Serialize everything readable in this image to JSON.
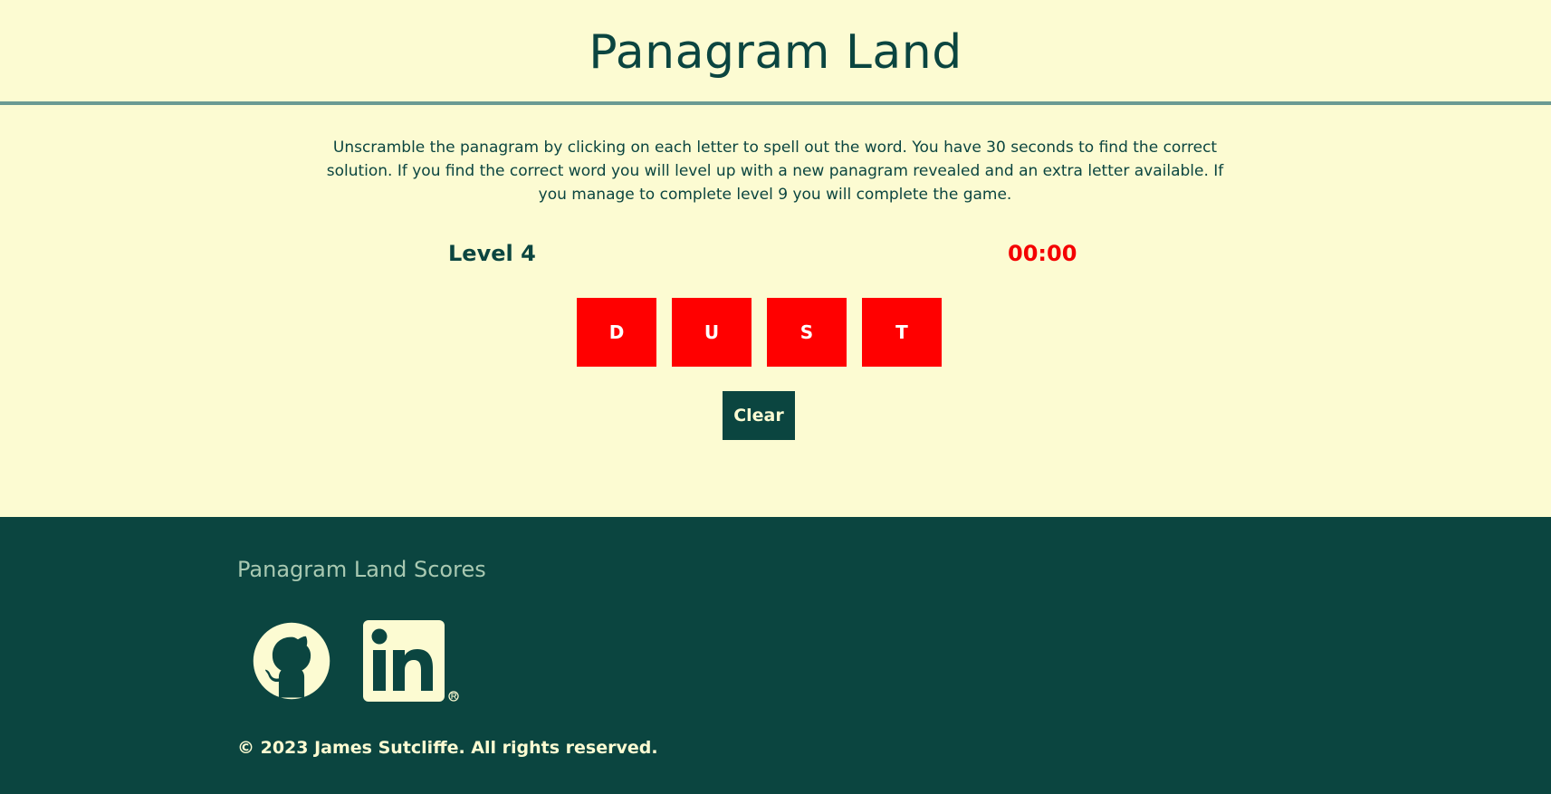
{
  "header": {
    "title": "Panagram Land"
  },
  "game": {
    "instructions": "Unscramble the panagram by clicking on each letter to spell out the word. You have 30 seconds to find the correct solution. If you find the correct word you will level up with a new panagram revealed and an extra letter available. If you manage to complete level 9 you will complete the game.",
    "level_label": "Level 4",
    "timer": "00:00",
    "tiles": [
      "D",
      "U",
      "S",
      "T"
    ],
    "clear_label": "Clear"
  },
  "footer": {
    "title": "Panagram Land Scores",
    "social": [
      {
        "icon": "github-icon"
      },
      {
        "icon": "linkedin-icon"
      }
    ],
    "copyright": "© 2023 James Sutcliffe. All rights reserved."
  },
  "colors": {
    "background": "#fcfbd2",
    "primary": "#0b4540",
    "tile": "#ff0000",
    "timer": "#f40000",
    "footer_heading": "#a9c9b2",
    "divider": "#6a9a93"
  }
}
